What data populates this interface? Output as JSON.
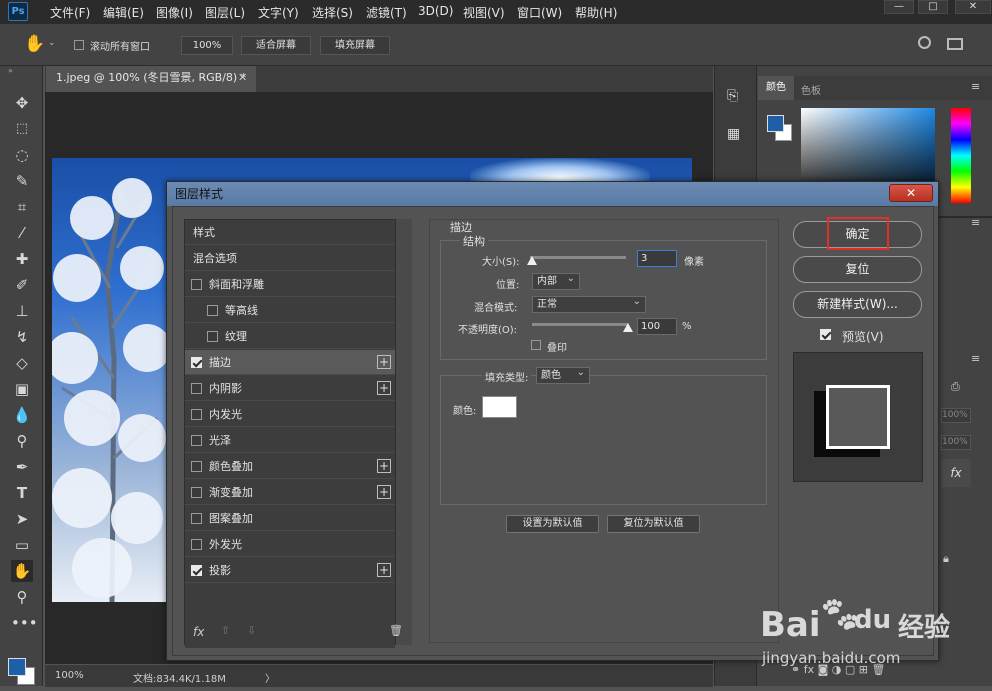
{
  "app": {
    "logo": "Ps"
  },
  "menu": [
    "文件(F)",
    "编辑(E)",
    "图像(I)",
    "图层(L)",
    "文字(Y)",
    "选择(S)",
    "滤镜(T)",
    "3D(D)",
    "视图(V)",
    "窗口(W)",
    "帮助(H)"
  ],
  "window_controls": {
    "minimize": "—",
    "maximize": "□",
    "close": "✕"
  },
  "options_bar": {
    "scroll_all_label": "滚动所有窗口",
    "zoom_100": "100%",
    "fit_screen": "适合屏幕",
    "fill_screen": "填充屏幕"
  },
  "document_tab": {
    "title": "1.jpeg @ 100% (冬日雪景, RGB/8) *",
    "close": "✕"
  },
  "status_bar": {
    "zoom": "100%",
    "doc_info": "文档:834.4K/1.18M",
    "arrow": "〉"
  },
  "right_panel": {
    "tabs": [
      "颜色",
      "色板"
    ],
    "foreground_color": "#1f5fa8",
    "background_color": "#ffffff",
    "opacity_a": "100%",
    "opacity_b": "100%",
    "fx_label": "fx"
  },
  "dialog": {
    "title": "图层样式",
    "close": "✕",
    "style_list": [
      {
        "label": "样式",
        "checkbox": false,
        "checked": false,
        "plus": false,
        "indent": 0,
        "selected": false
      },
      {
        "label": "混合选项",
        "checkbox": false,
        "checked": false,
        "plus": false,
        "indent": 0,
        "selected": false
      },
      {
        "label": "斜面和浮雕",
        "checkbox": true,
        "checked": false,
        "plus": false,
        "indent": 0,
        "selected": false
      },
      {
        "label": "等高线",
        "checkbox": true,
        "checked": false,
        "plus": false,
        "indent": 1,
        "selected": false
      },
      {
        "label": "纹理",
        "checkbox": true,
        "checked": false,
        "plus": false,
        "indent": 1,
        "selected": false
      },
      {
        "label": "描边",
        "checkbox": true,
        "checked": true,
        "plus": true,
        "indent": 0,
        "selected": true
      },
      {
        "label": "内阴影",
        "checkbox": true,
        "checked": false,
        "plus": true,
        "indent": 0,
        "selected": false
      },
      {
        "label": "内发光",
        "checkbox": true,
        "checked": false,
        "plus": false,
        "indent": 0,
        "selected": false
      },
      {
        "label": "光泽",
        "checkbox": true,
        "checked": false,
        "plus": false,
        "indent": 0,
        "selected": false
      },
      {
        "label": "颜色叠加",
        "checkbox": true,
        "checked": false,
        "plus": true,
        "indent": 0,
        "selected": false
      },
      {
        "label": "渐变叠加",
        "checkbox": true,
        "checked": false,
        "plus": true,
        "indent": 0,
        "selected": false
      },
      {
        "label": "图案叠加",
        "checkbox": true,
        "checked": false,
        "plus": false,
        "indent": 0,
        "selected": false
      },
      {
        "label": "外发光",
        "checkbox": true,
        "checked": false,
        "plus": false,
        "indent": 0,
        "selected": false
      },
      {
        "label": "投影",
        "checkbox": true,
        "checked": true,
        "plus": true,
        "indent": 0,
        "selected": false
      }
    ],
    "footer": {
      "fx": "fx",
      "up": "⇧",
      "down": "⇩",
      "trash": "🗑"
    },
    "stroke": {
      "section_title": "描边",
      "structure_title": "结构",
      "size_label": "大小(S):",
      "size_value": "3",
      "size_unit": "像素",
      "size_fraction": 0.02,
      "position_label": "位置:",
      "position_value": "内部",
      "blend_label": "混合模式:",
      "blend_value": "正常",
      "opacity_label": "不透明度(O):",
      "opacity_value": "100",
      "opacity_unit": "%",
      "opacity_fraction": 1.0,
      "overprint_label": "叠印",
      "fill_type_label": "填充类型:",
      "fill_type_value": "颜色",
      "color_label": "颜色:",
      "stroke_color": "#ffffff",
      "set_default": "设置为默认值",
      "reset_default": "复位为默认值"
    },
    "buttons": {
      "ok": "确定",
      "reset": "复位",
      "new_style": "新建样式(W)...",
      "preview_label": "预览(V)",
      "preview_checked": true
    }
  },
  "watermark": {
    "brand": "Bai",
    "brand2": "du",
    "brand_cn": "经验",
    "url": "jingyan.baidu.com"
  }
}
